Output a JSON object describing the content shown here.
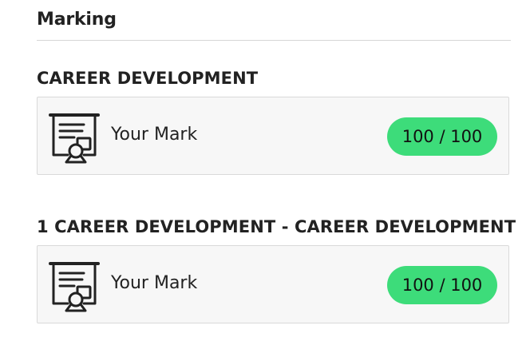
{
  "header": {
    "title": "Marking"
  },
  "sections": [
    {
      "title": "CAREER DEVELOPMENT",
      "card": {
        "icon": "certificate-icon",
        "label": "Your Mark",
        "score": "100 / 100"
      }
    },
    {
      "title": "1 CAREER DEVELOPMENT - CAREER DEVELOPMENT",
      "card": {
        "icon": "certificate-icon",
        "label": "Your Mark",
        "score": "100 / 100"
      }
    }
  ],
  "colors": {
    "badge": "#3ddc7a",
    "card_background": "#f7f7f7",
    "text": "#222222"
  }
}
